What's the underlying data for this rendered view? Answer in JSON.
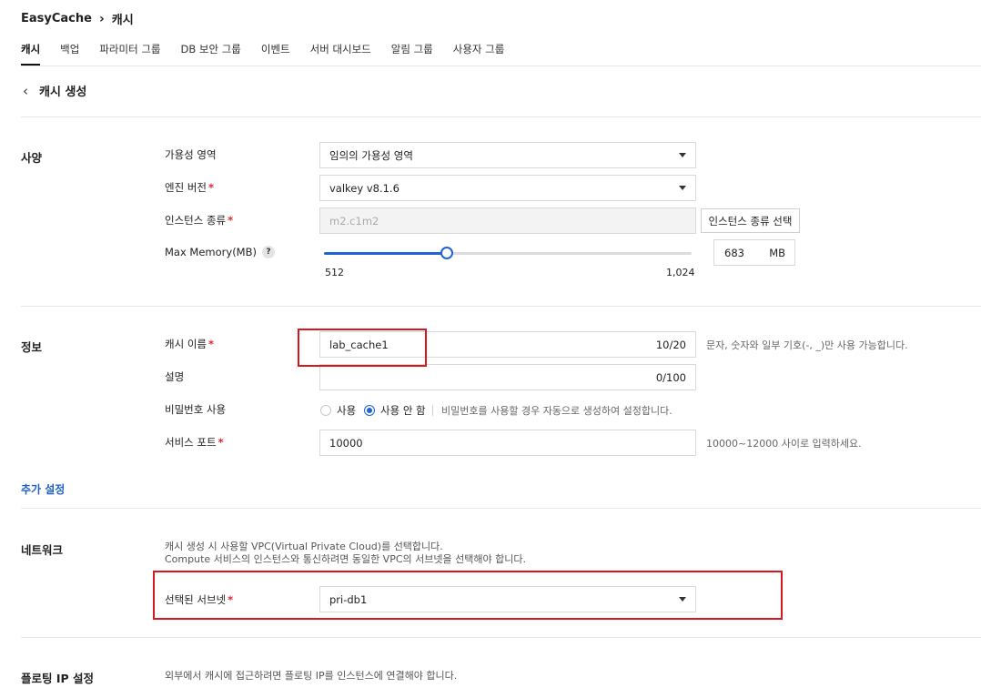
{
  "breadcrumb": {
    "service": "EasyCache",
    "current": "캐시"
  },
  "tabs": [
    "캐시",
    "백업",
    "파라미터 그룹",
    "DB 보안 그룹",
    "이벤트",
    "서버 대시보드",
    "알림 그룹",
    "사용자 그룹"
  ],
  "page": {
    "title": "캐시 생성"
  },
  "spec": {
    "section_title": "사양",
    "availability_zone": {
      "label": "가용성 영역",
      "value": "임의의 가용성 영역"
    },
    "engine_version": {
      "label": "엔진 버전",
      "value": "valkey v8.1.6"
    },
    "instance_type": {
      "label": "인스턴스 종류",
      "placeholder": "m2.c1m2",
      "button": "인스턴스 종류 선택"
    },
    "max_memory": {
      "label": "Max Memory(MB)",
      "help": "?",
      "min": 512,
      "max": 1024,
      "min_label": "512",
      "max_label": "1,024",
      "value": 683,
      "value_label": "683",
      "unit": "MB"
    }
  },
  "info": {
    "section_title": "정보",
    "cache_name": {
      "label": "캐시 이름",
      "value": "lab_cache1",
      "counter": "10/20",
      "hint": "문자, 숫자와 일부 기호(-, _)만 사용 가능합니다."
    },
    "description": {
      "label": "설명",
      "value": "",
      "counter": "0/100"
    },
    "password": {
      "label": "비밀번호 사용",
      "option_use": "사용",
      "option_no": "사용 안 함",
      "selected": "사용 안 함",
      "hint": "비밀번호를 사용할 경우 자동으로 생성하여 설정합니다."
    },
    "service_port": {
      "label": "서비스 포트",
      "value": "10000",
      "hint": "10000~12000 사이로 입력하세요."
    }
  },
  "advanced_link": "추가 설정",
  "network": {
    "section_title": "네트워크",
    "desc_line1": "캐시 생성 시 사용할 VPC(Virtual Private Cloud)를 선택합니다.",
    "desc_line2": "Compute 서비스의 인스턴스와 통신하려면 동일한 VPC의 서브넷을 선택해야 합니다.",
    "subnet": {
      "label": "선택된 서브넷",
      "value": "pri-db1"
    }
  },
  "floating_ip": {
    "section_title": "플로팅 IP 설정",
    "desc": "외부에서 캐시에 접근하려면 플로팅 IP를 인스턴스에 연결해야 합니다."
  },
  "colors": {
    "accent": "#1f63d6",
    "required": "#e0252e",
    "highlight": "#d6171e",
    "link": "#1f5fc8"
  }
}
